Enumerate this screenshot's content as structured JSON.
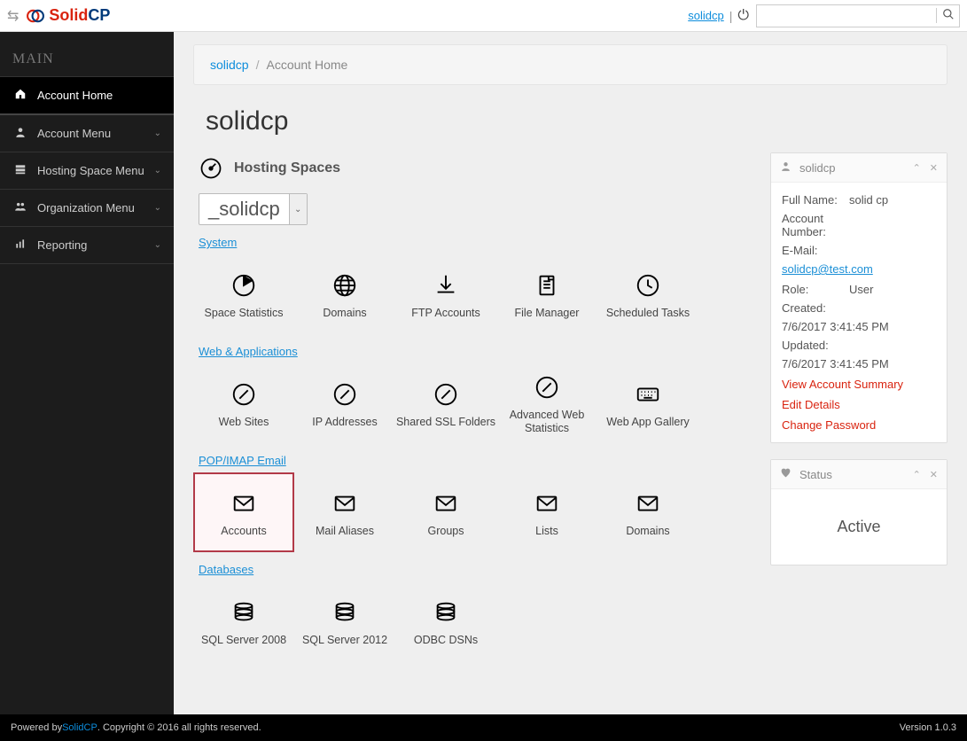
{
  "topbar": {
    "logo_solid": "Solid",
    "logo_cp": "CP",
    "user_link": "solidcp",
    "separator": "|",
    "search_placeholder": ""
  },
  "sidebar": {
    "heading": "MAIN",
    "items": [
      {
        "label": "Account Home",
        "icon": "home",
        "active": true,
        "expandable": false
      },
      {
        "label": "Account Menu",
        "icon": "user",
        "active": false,
        "expandable": true
      },
      {
        "label": "Hosting Space Menu",
        "icon": "server",
        "active": false,
        "expandable": true
      },
      {
        "label": "Organization Menu",
        "icon": "users",
        "active": false,
        "expandable": true
      },
      {
        "label": "Reporting",
        "icon": "chart",
        "active": false,
        "expandable": true
      }
    ]
  },
  "breadcrumb": {
    "root": "solidcp",
    "current": "Account Home"
  },
  "page_title": "solidcp",
  "hosting": {
    "section_title": "Hosting Spaces",
    "selected_space": "_solidcp",
    "categories": [
      {
        "name": "System",
        "tiles": [
          {
            "label": "Space Statistics",
            "icon": "piechart"
          },
          {
            "label": "Domains",
            "icon": "globe"
          },
          {
            "label": "FTP Accounts",
            "icon": "download"
          },
          {
            "label": "File Manager",
            "icon": "filemgr"
          },
          {
            "label": "Scheduled Tasks",
            "icon": "clock"
          }
        ]
      },
      {
        "name": "Web & Applications",
        "tiles": [
          {
            "label": "Web Sites",
            "icon": "compass"
          },
          {
            "label": "IP Addresses",
            "icon": "compass"
          },
          {
            "label": "Shared SSL Folders",
            "icon": "compass"
          },
          {
            "label": "Advanced Web Statistics",
            "icon": "compass"
          },
          {
            "label": "Web App Gallery",
            "icon": "keyboard"
          }
        ]
      },
      {
        "name": "POP/IMAP Email",
        "tiles": [
          {
            "label": "Accounts",
            "icon": "mail",
            "highlight": true
          },
          {
            "label": "Mail Aliases",
            "icon": "mail"
          },
          {
            "label": "Groups",
            "icon": "mail"
          },
          {
            "label": "Lists",
            "icon": "mail"
          },
          {
            "label": "Domains",
            "icon": "mail"
          }
        ]
      },
      {
        "name": "Databases",
        "tiles": [
          {
            "label": "SQL Server 2008",
            "icon": "db"
          },
          {
            "label": "SQL Server 2012",
            "icon": "db"
          },
          {
            "label": "ODBC DSNs",
            "icon": "db"
          }
        ]
      }
    ]
  },
  "user_panel": {
    "title": "solidcp",
    "fullname_label": "Full Name:",
    "fullname_value": "solid cp",
    "account_label": "Account Number:",
    "account_value": "",
    "email_label": "E-Mail:",
    "email_value": "solidcp@test.com",
    "role_label": "Role:",
    "role_value": "User",
    "created_label": "Created:",
    "created_value": "7/6/2017 3:41:45 PM",
    "updated_label": "Updated:",
    "updated_value": "7/6/2017 3:41:45 PM",
    "actions": [
      "View Account Summary",
      "Edit Details",
      "Change Password"
    ]
  },
  "status_panel": {
    "title": "Status",
    "value": "Active"
  },
  "footer": {
    "prefix": "Powered by ",
    "link": "SolidCP",
    "suffix": ". Copyright © 2016 all rights reserved.",
    "version": "Version 1.0.3"
  }
}
